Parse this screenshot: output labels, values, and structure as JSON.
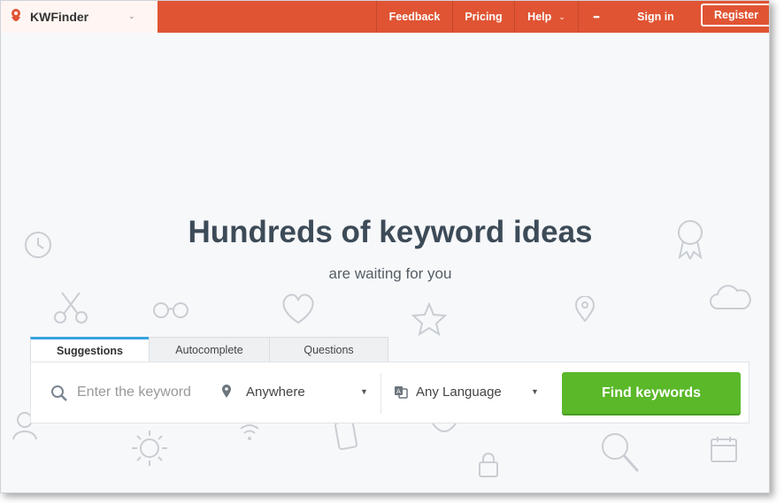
{
  "brand": {
    "name": "KWFinder",
    "caret": "⌄"
  },
  "nav": {
    "feedback": "Feedback",
    "pricing": "Pricing",
    "help": "Help",
    "help_caret": "⌄",
    "more": "•••",
    "signin": "Sign in",
    "register": "Register"
  },
  "hero": {
    "title": "Hundreds of keyword ideas",
    "subtitle": "are waiting for you"
  },
  "tabs": [
    {
      "label": "Suggestions",
      "active": true
    },
    {
      "label": "Autocomplete",
      "active": false
    },
    {
      "label": "Questions",
      "active": false
    }
  ],
  "search": {
    "placeholder": "Enter the keyword",
    "location": "Anywhere",
    "language": "Any Language",
    "button": "Find keywords"
  },
  "colors": {
    "topbar": "#e05433",
    "accent_tab": "#36a3e0",
    "button": "#5ab829",
    "headline": "#3d4b58"
  },
  "icons": {
    "logo": "kwfinder-logo-icon",
    "search": "search-icon",
    "location": "map-pin-icon",
    "language": "language-icon",
    "dropdown": "dropdown-arrow-icon"
  }
}
